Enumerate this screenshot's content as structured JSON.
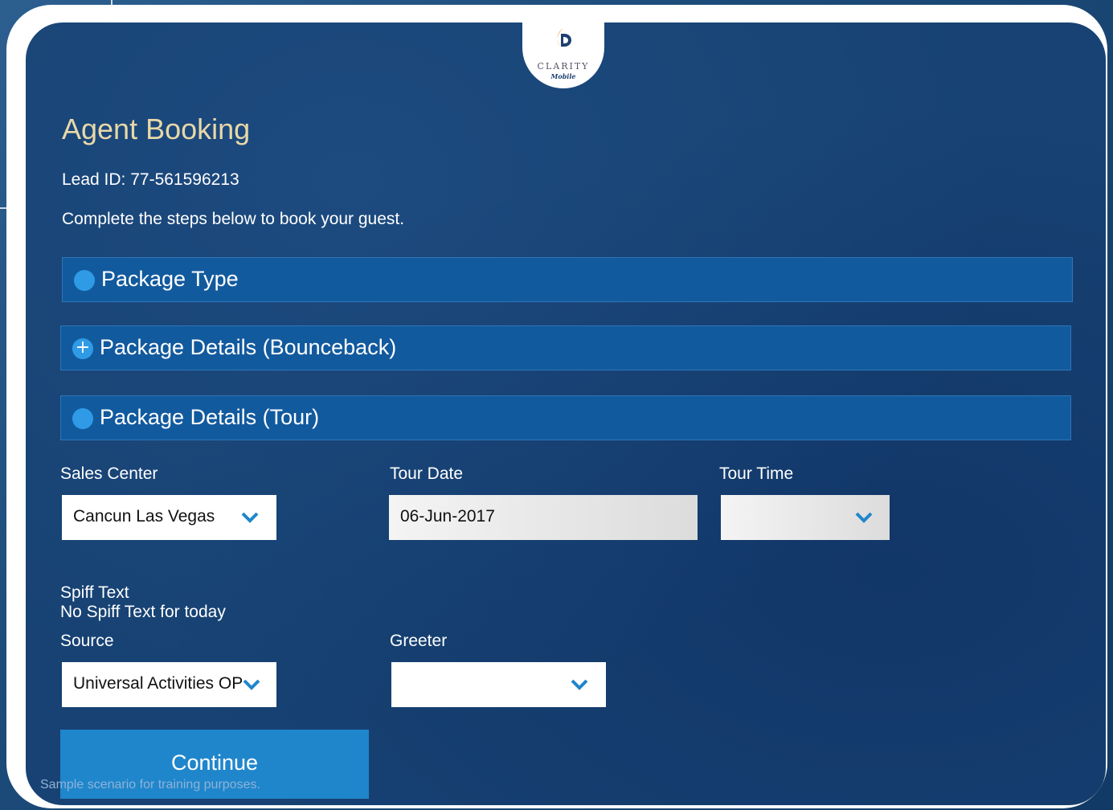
{
  "brand": {
    "name": "CLARITY",
    "sub": "Mobile",
    "accent": "#e8d8a8"
  },
  "page": {
    "title": "Agent Booking",
    "lead_id": "Lead ID: 77-561596213",
    "intro": "Complete the steps below to book your guest."
  },
  "sections": [
    {
      "label": "Package Type",
      "icon": "circle-icon"
    },
    {
      "label": "Package Details (Bounceback)",
      "icon": "plus-circle-icon"
    },
    {
      "label": "Package Details (Tour)",
      "icon": "circle-icon"
    }
  ],
  "form": {
    "sales_center": {
      "label": "Sales Center",
      "value": "Cancun Las Vegas"
    },
    "tour_date": {
      "label": "Tour Date",
      "value": "06-Jun-2017"
    },
    "tour_time": {
      "label": "Tour Time",
      "value": ""
    },
    "spiff": {
      "label": "Spiff Text",
      "value": "No Spiff Text for today"
    },
    "source": {
      "label": "Source",
      "value": "Universal Activities OP"
    },
    "greeter": {
      "label": "Greeter",
      "value": ""
    }
  },
  "actions": {
    "continue_label": "Continue"
  },
  "footer": {
    "disclaimer": "Sample scenario for training purposes."
  },
  "colors": {
    "background": "#174273",
    "section": "#125a9e",
    "button": "#1f86cc",
    "chevron": "#1f86cc"
  }
}
